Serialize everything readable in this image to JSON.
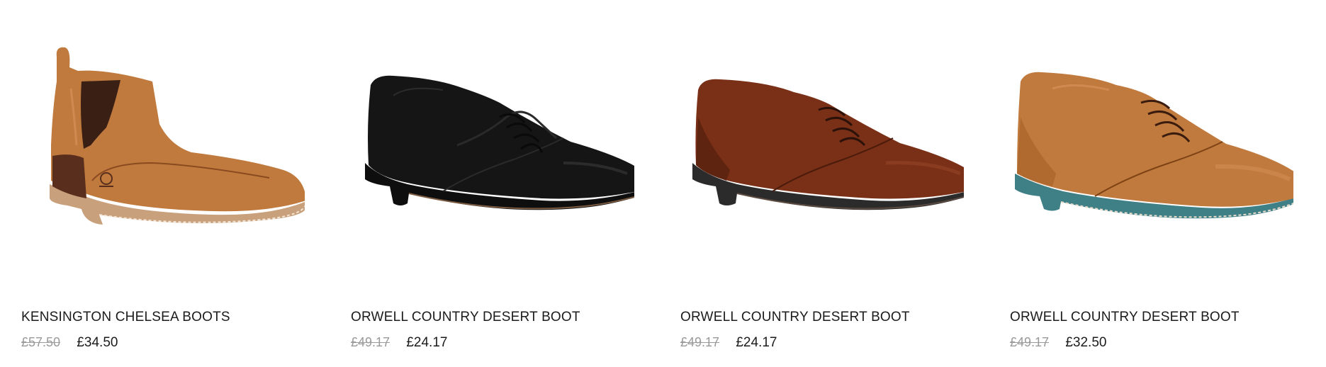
{
  "products": [
    {
      "name": "KENSINGTON CHELSEA BOOTS",
      "old_price": "£57.50",
      "price": "£34.50",
      "image": "chelsea-boot-tan"
    },
    {
      "name": "ORWELL COUNTRY DESERT BOOT",
      "old_price": "£49.17",
      "price": "£24.17",
      "image": "desert-boot-black"
    },
    {
      "name": "ORWELL COUNTRY DESERT BOOT",
      "old_price": "£49.17",
      "price": "£24.17",
      "image": "desert-boot-brown"
    },
    {
      "name": "ORWELL COUNTRY DESERT BOOT",
      "old_price": "£49.17",
      "price": "£32.50",
      "image": "desert-boot-tan-blue-sole"
    }
  ],
  "colors": {
    "tan": "#c07a3e",
    "black": "#151515",
    "brown": "#7a2f17",
    "teal_sole": "#3f7f86",
    "text": "#1b1b1b",
    "old_price": "#9a9a9a"
  }
}
